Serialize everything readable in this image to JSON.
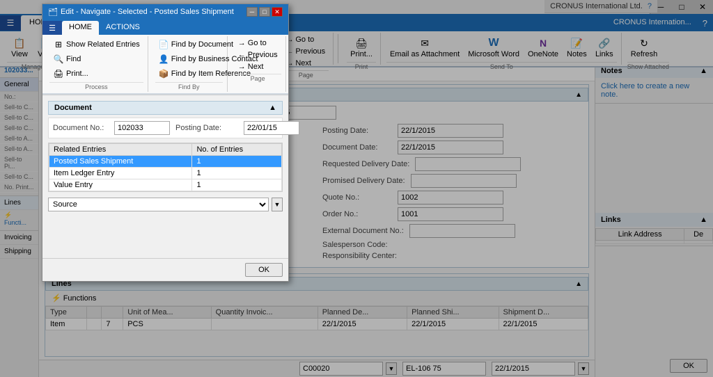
{
  "app": {
    "title": "Edit - Navigate - Selected - Posted Sales Shipment",
    "company": "CRONUS International Ltd.",
    "window_controls": [
      "─",
      "□",
      "✕"
    ]
  },
  "ribbon": {
    "tabs": [
      "HOME",
      "ACTIONS"
    ],
    "company_name": "CRONUS Internation...",
    "help_icon": "?",
    "groups": {
      "manage": {
        "label": "Manage",
        "buttons": [
          {
            "label": "View",
            "icon": "👁"
          },
          {
            "label": "View",
            "icon": "📄"
          }
        ],
        "small_buttons": [
          "Ma..."
        ]
      },
      "process": {
        "label": "Process",
        "small_buttons": [
          "Show Related Entries",
          "Find",
          "Print..."
        ]
      },
      "find_by": {
        "label": "Find By",
        "small_buttons": [
          "Find by Document",
          "Find by Business Contact",
          "Find by Item Reference"
        ]
      },
      "page": {
        "label": "Page",
        "small_buttons": [
          "→ Go to",
          "← Previous",
          "→ Next"
        ]
      },
      "print": {
        "label": "Print",
        "buttons": [
          {
            "label": "Print...",
            "icon": "🖨"
          }
        ]
      },
      "send_to": {
        "label": "Send To",
        "buttons": [
          {
            "label": "Email as Attachment",
            "icon": "✉"
          },
          {
            "label": "Microsoft Word",
            "icon": "W"
          },
          {
            "label": "OneNote",
            "icon": "N"
          },
          {
            "label": "Notes",
            "icon": "📝"
          },
          {
            "label": "Links",
            "icon": "🔗"
          }
        ]
      },
      "show_attached": {
        "label": "Show Attached",
        "buttons": [
          {
            "label": "Refresh",
            "icon": "↻"
          }
        ]
      }
    }
  },
  "main_page": {
    "title": "Selected - Posted Sales Shipment",
    "doc_no": "102033",
    "breadcrumb": "102033...",
    "section_tabs": [
      "General",
      "Lines",
      "Invoicing",
      "Shipping"
    ],
    "side_list_items": [
      "No.:",
      "Sell-to C...",
      "Sell-to C...",
      "Sell-to C...",
      "Sell-to A...",
      "Sell-to A...",
      "Sell-to Pi...",
      "Sell-to C...",
      "No. Print..."
    ],
    "sections": {
      "lines": {
        "label": "Lines"
      },
      "functions": {
        "label": "Functions"
      }
    },
    "lines_columns": [
      "Type",
      ""
    ],
    "lines_rows": [
      {
        "type": "Item",
        "value": ""
      }
    ],
    "bottom_fields": {
      "field1": "C00020",
      "field2": "EL-106 75",
      "field3": "22/1/2015"
    }
  },
  "form_fields": {
    "posting_date_label": "Posting Date:",
    "posting_date_value": "22/1/2015",
    "document_date_label": "Document Date:",
    "document_date_value": "22/1/2015",
    "requested_delivery_label": "Requested Delivery Date:",
    "promised_delivery_label": "Promised Delivery Date:",
    "quote_no_label": "Quote No.:",
    "quote_no_value": "1002",
    "order_no_label": "Order No.:",
    "order_no_value": "1001",
    "external_doc_label": "External Document No.:",
    "salesperson_label": "Salesperson Code:",
    "responsibility_label": "Responsibility Center:"
  },
  "lines_table": {
    "columns": [
      "",
      "Unit of Mea...",
      "Quantity Invoic...",
      "Planned De...",
      "Planned Shi...",
      "Shipment D..."
    ],
    "rows": [
      {
        "qty": "7",
        "uom": "PCS",
        "qty_inv": "",
        "planned_de": "22/1/2015",
        "planned_shi": "22/1/2015",
        "shipment": "22/1/2015"
      }
    ]
  },
  "notes_panel": {
    "title": "Notes",
    "create_note_link": "Click here to create a new note."
  },
  "links_panel": {
    "title": "Links",
    "col1": "Link Address",
    "col2": "De"
  },
  "dialog": {
    "title": "Edit - Navigate - Selected - Posted Sales Shipment",
    "ribbon_tabs": [
      "HOME",
      "ACTIONS"
    ],
    "sections": {
      "document": {
        "label": "Document",
        "doc_no_label": "Document No.:",
        "doc_no_value": "102033",
        "posting_date_label": "Posting Date:",
        "posting_date_value": "22/01/15"
      },
      "table": {
        "col_related": "Related Entries",
        "col_entries": "No. of Entries",
        "rows": [
          {
            "entry": "Posted Sales Shipment",
            "count": "1",
            "selected": true
          },
          {
            "entry": "Item Ledger Entry",
            "count": "1",
            "selected": false
          },
          {
            "entry": "Value Entry",
            "count": "1",
            "selected": false
          }
        ]
      }
    },
    "source_label": "Source",
    "ok_label": "OK",
    "ribbon": {
      "process_group": {
        "label": "Process",
        "btns": [
          "Show Related Entries",
          "Find",
          "Print..."
        ]
      },
      "find_by_group": {
        "label": "Find By",
        "btns": [
          "Find by Document",
          "Find by Business Contact",
          "Find by Item Reference"
        ]
      },
      "page_group": {
        "label": "Page",
        "btns": [
          "→ Go to",
          "← Previous",
          "→ Next"
        ]
      }
    }
  },
  "status_bar": {
    "text": ""
  }
}
